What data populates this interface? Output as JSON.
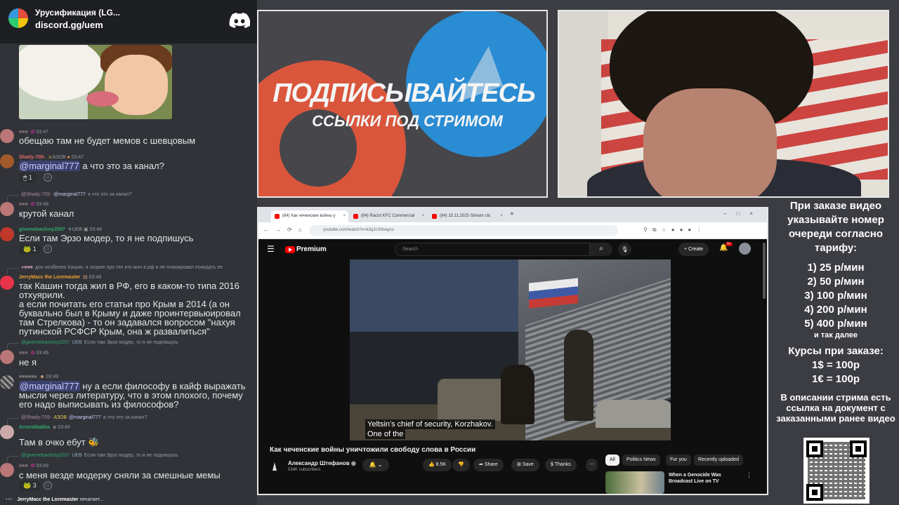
{
  "discord": {
    "server_name": "Урусификация (LG...",
    "server_link": "discord.gg/uem",
    "typing_user": "JerryMacc the Loremaster",
    "typing_suffix": "печатает...",
    "messages": {
      "m1": {
        "author": "",
        "time": "03:47",
        "text": "обещаю там не будет мемов с шевцовым"
      },
      "m2": {
        "author": "Shady-705-",
        "badge": "АЗОВ",
        "time": "03:47",
        "mention": "@marginal777",
        "text": " а что это за канал?",
        "reaction_count": "1"
      },
      "m3": {
        "reply_author": "@Shady-705-",
        "reply_mention": "@marginal777",
        "reply_text": "а что это за канал?",
        "author": "",
        "time": "03:48",
        "text": "крутой канал"
      },
      "m4": {
        "author": "givemebackmy2007",
        "badge": "UEB",
        "time": "03:48",
        "text": "Если там Эрзо модер, то я не подпишусь",
        "reaction_count": "1"
      },
      "m5": {
        "reply_text": "доо особенно Кашин, я скорее про тех кто жил в рф и не планировал покидать ее",
        "author": "JerryMacc the Loremaster",
        "time": "03:48",
        "text": "так Кашин тогда жил в РФ, его в каком-то типа 2016 отхуярили.\nа если почитать его статьи про Крым в 2014 (а он буквально был в Крыму и даже проинтервьюировал там Стрелкова) - то он задавался вопросом \"нахуя путинской РСФСР Крым, она ж развалиться\""
      },
      "m6": {
        "reply_author": "@givemebackmy2007",
        "reply_badge": "UEB",
        "reply_text": "Если там Эрзо модер, то я не подпишусь",
        "author": "",
        "time": "03:49",
        "text": "не я"
      },
      "m7": {
        "author": "",
        "time": "03:49",
        "mention": "@marginal777",
        "text": " ну а если философу в кайф выражать мысли через литературу, что в этом плохого, почему его надо выписывать из философов?"
      },
      "m8": {
        "reply_author": "@Shady-705-",
        "reply_badge": "АЗОВ",
        "reply_mention": "@marginal777",
        "reply_text": "а что это за канал?",
        "author": "Arsentikakha",
        "time": "03:49",
        "text": "Там в очко ебут"
      },
      "m9": {
        "reply_author": "@givemebackmy2007",
        "reply_badge": "UEB",
        "reply_text": "Если там Эрзо модер, то я не подпишусь",
        "author": "",
        "time": "03:49",
        "text": "с меня везде модерку сняли за смешные мемы",
        "reaction_count": "3"
      }
    }
  },
  "banner": {
    "title": "ПОДПИСЫВАЙТЕСЬ",
    "subtitle": "ССЫЛКИ ПОД СТРИМОМ"
  },
  "browser": {
    "tabs": {
      "t1": "(64) Как чеченские войны у",
      "t2": "(64) Racist KFC Commercial",
      "t3": "(64) 15.11.2025 Stream clo"
    },
    "url": "youtube.com/watch?v=k3qJcXNvaycs"
  },
  "youtube": {
    "brand": "Premium",
    "search_placeholder": "Search",
    "create_label": "Create",
    "notif_count": "9+",
    "caption_line1": "Yeltsin's chief of security, Korzhakov.",
    "caption_line2": "One of the",
    "video_title": "Как чеченские войны уничтожили свободу слова в России",
    "channel_name": "Александр Штефанов",
    "channel_verified": "◉",
    "subscribers": "534K subscribers",
    "likes": "8.5K",
    "share": "Share",
    "save": "Save",
    "thanks": "Thanks",
    "chips": {
      "c1": "All",
      "c2": "Politics News",
      "c3": "For you",
      "c4": "Recently uploaded"
    },
    "rec_title": "When a Genocide Was Broadcast Live on TV"
  },
  "info": {
    "intro": "При заказе видео указывайте номер очереди согласно тарифу:",
    "tariffs": {
      "r1": "1) 25 р/мин",
      "r2": "2) 50 р/мин",
      "r3": "3) 100 р/мин",
      "r4": "4) 200 р/мин",
      "r5": "5) 400 р/мин"
    },
    "etc": "и так далее",
    "courses_title": "Курсы при заказе:",
    "usd": "1$ = 100р",
    "eur": "1€ = 100р",
    "note": "В описании стрима есть ссылка на документ с заказанными ранее видео"
  },
  "colors": {
    "discord_bg": "#313338",
    "mention_bg": "#3c4270",
    "youtube_red": "#ff0000",
    "banner_orange": "#d9563c",
    "banner_blue": "#2a8cd3"
  }
}
